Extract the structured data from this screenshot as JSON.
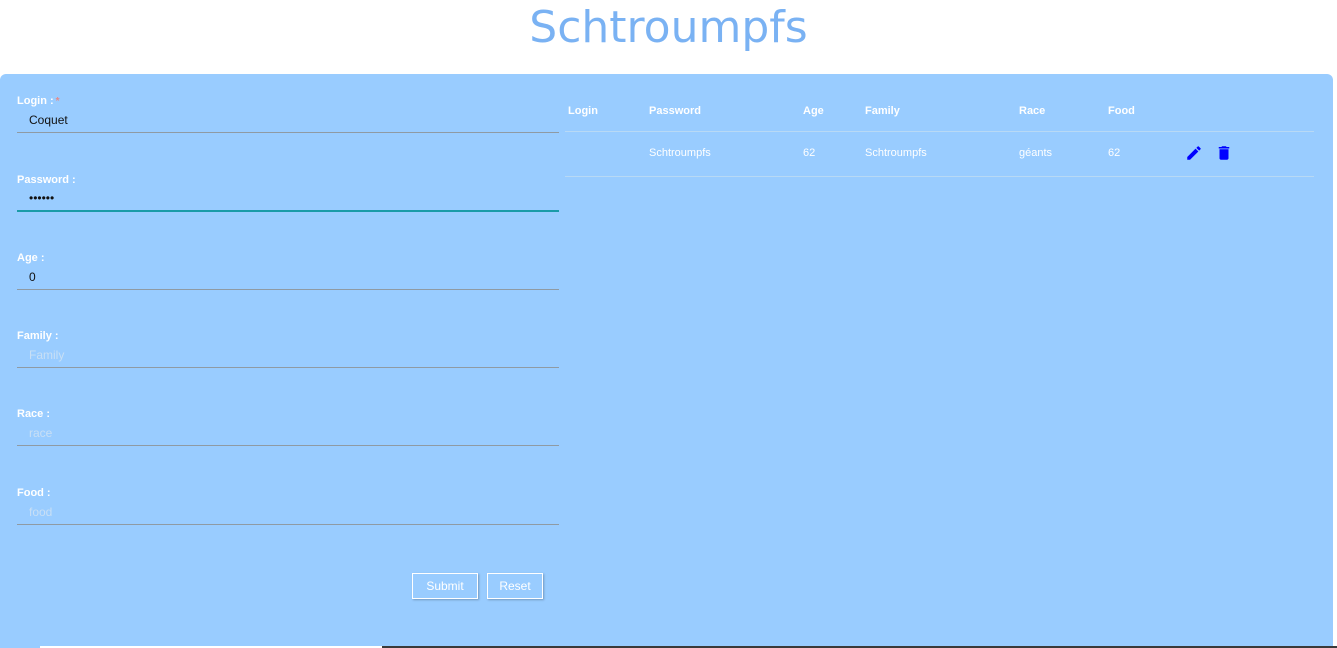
{
  "app": {
    "title": "Schtroumpfs"
  },
  "form": {
    "login": {
      "label": "Login :",
      "required_mark": "*",
      "value": "Coquet",
      "placeholder": ""
    },
    "password": {
      "label": "Password :",
      "value": "••••••"
    },
    "age": {
      "label": "Age :",
      "value": "0"
    },
    "family": {
      "label": "Family :",
      "placeholder": "Family"
    },
    "race": {
      "label": "Race :",
      "placeholder": "race"
    },
    "food": {
      "label": "Food :",
      "placeholder": "food"
    },
    "submit_label": "Submit",
    "reset_label": "Reset"
  },
  "table": {
    "headers": [
      "Login",
      "Password",
      "Age",
      "Family",
      "Race",
      "Food"
    ],
    "rows": [
      {
        "login": "",
        "password": "Schtroumpfs",
        "age": "62",
        "family": "Schtroumpfs",
        "race": "géants",
        "food": "62"
      }
    ],
    "icons": {
      "edit": "pencil-icon",
      "delete": "trash-icon"
    },
    "icon_color": "#0000ff"
  },
  "colors": {
    "panel": "#99ccff",
    "title": "#7ab2f3",
    "focus": "#1a9ba8"
  }
}
